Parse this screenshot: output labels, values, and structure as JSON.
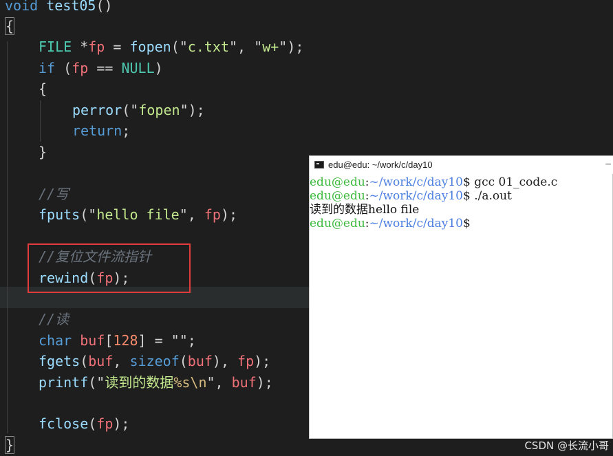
{
  "editor": {
    "lines": [
      [
        {
          "t": "void",
          "c": "kw"
        },
        {
          "t": " ",
          "c": "punc"
        },
        {
          "t": "test05",
          "c": "fn"
        },
        {
          "t": "()",
          "c": "punc"
        }
      ],
      [
        {
          "t": "{",
          "c": "punc"
        }
      ],
      [
        {
          "t": "FILE",
          "c": "type"
        },
        {
          "t": " *",
          "c": "op"
        },
        {
          "t": "fp",
          "c": "var"
        },
        {
          "t": " = ",
          "c": "op"
        },
        {
          "t": "fopen",
          "c": "fn"
        },
        {
          "t": "(\"",
          "c": "punc"
        },
        {
          "t": "c.txt",
          "c": "str"
        },
        {
          "t": "\", \"",
          "c": "punc"
        },
        {
          "t": "w+",
          "c": "str"
        },
        {
          "t": "\");",
          "c": "punc"
        }
      ],
      [
        {
          "t": "if",
          "c": "kw"
        },
        {
          "t": " (",
          "c": "punc"
        },
        {
          "t": "fp",
          "c": "var"
        },
        {
          "t": " == ",
          "c": "op"
        },
        {
          "t": "NULL",
          "c": "type"
        },
        {
          "t": ")",
          "c": "punc"
        }
      ],
      [
        {
          "t": "{",
          "c": "punc"
        }
      ],
      [
        {
          "t": "perror",
          "c": "fn"
        },
        {
          "t": "(\"",
          "c": "punc"
        },
        {
          "t": "fopen",
          "c": "str"
        },
        {
          "t": "\");",
          "c": "punc"
        }
      ],
      [
        {
          "t": "return",
          "c": "kw"
        },
        {
          "t": ";",
          "c": "punc"
        }
      ],
      [
        {
          "t": "}",
          "c": "punc"
        }
      ],
      [],
      [
        {
          "t": "//写",
          "c": "comment"
        }
      ],
      [
        {
          "t": "fputs",
          "c": "fn"
        },
        {
          "t": "(\"",
          "c": "punc"
        },
        {
          "t": "hello file",
          "c": "str"
        },
        {
          "t": "\", ",
          "c": "punc"
        },
        {
          "t": "fp",
          "c": "var"
        },
        {
          "t": ");",
          "c": "punc"
        }
      ],
      [],
      [
        {
          "t": "//复位文件流指针",
          "c": "comment"
        }
      ],
      [
        {
          "t": "rewind",
          "c": "fn"
        },
        {
          "t": "(",
          "c": "punc"
        },
        {
          "t": "fp",
          "c": "var"
        },
        {
          "t": ");",
          "c": "punc"
        }
      ],
      [],
      [
        {
          "t": "//读",
          "c": "comment"
        }
      ],
      [
        {
          "t": "char",
          "c": "kw"
        },
        {
          "t": " ",
          "c": "punc"
        },
        {
          "t": "buf",
          "c": "var"
        },
        {
          "t": "[",
          "c": "punc"
        },
        {
          "t": "128",
          "c": "num"
        },
        {
          "t": "] = \"\";",
          "c": "punc"
        }
      ],
      [
        {
          "t": "fgets",
          "c": "fn"
        },
        {
          "t": "(",
          "c": "punc"
        },
        {
          "t": "buf",
          "c": "var"
        },
        {
          "t": ", ",
          "c": "punc"
        },
        {
          "t": "sizeof",
          "c": "kw"
        },
        {
          "t": "(",
          "c": "punc"
        },
        {
          "t": "buf",
          "c": "var"
        },
        {
          "t": "), ",
          "c": "punc"
        },
        {
          "t": "fp",
          "c": "var"
        },
        {
          "t": ");",
          "c": "punc"
        }
      ],
      [
        {
          "t": "printf",
          "c": "fn"
        },
        {
          "t": "(\"",
          "c": "punc"
        },
        {
          "t": "读到的数据",
          "c": "str"
        },
        {
          "t": "%s\\n",
          "c": "esc"
        },
        {
          "t": "\", ",
          "c": "punc"
        },
        {
          "t": "buf",
          "c": "var"
        },
        {
          "t": ");",
          "c": "punc"
        }
      ],
      [],
      [
        {
          "t": "fclose",
          "c": "fn"
        },
        {
          "t": "(",
          "c": "punc"
        },
        {
          "t": "fp",
          "c": "var"
        },
        {
          "t": ");",
          "c": "punc"
        }
      ],
      [
        {
          "t": "}",
          "c": "punc"
        }
      ]
    ]
  },
  "terminal": {
    "title": "edu@edu: ~/work/c/day10",
    "minimize_glyph": "–",
    "lines": [
      {
        "user": "edu@edu",
        "sep": ":",
        "path": "~/work/c/day10",
        "prompt": "$ ",
        "cmd": "gcc 01_code.c"
      },
      {
        "user": "edu@edu",
        "sep": ":",
        "path": "~/work/c/day10",
        "prompt": "$ ",
        "cmd": "./a.out"
      },
      {
        "output": "读到的数据hello file"
      },
      {
        "user": "edu@edu",
        "sep": ":",
        "path": "~/work/c/day10",
        "prompt": "$",
        "cmd": ""
      }
    ]
  },
  "watermark": "CSDN @长流小哥"
}
